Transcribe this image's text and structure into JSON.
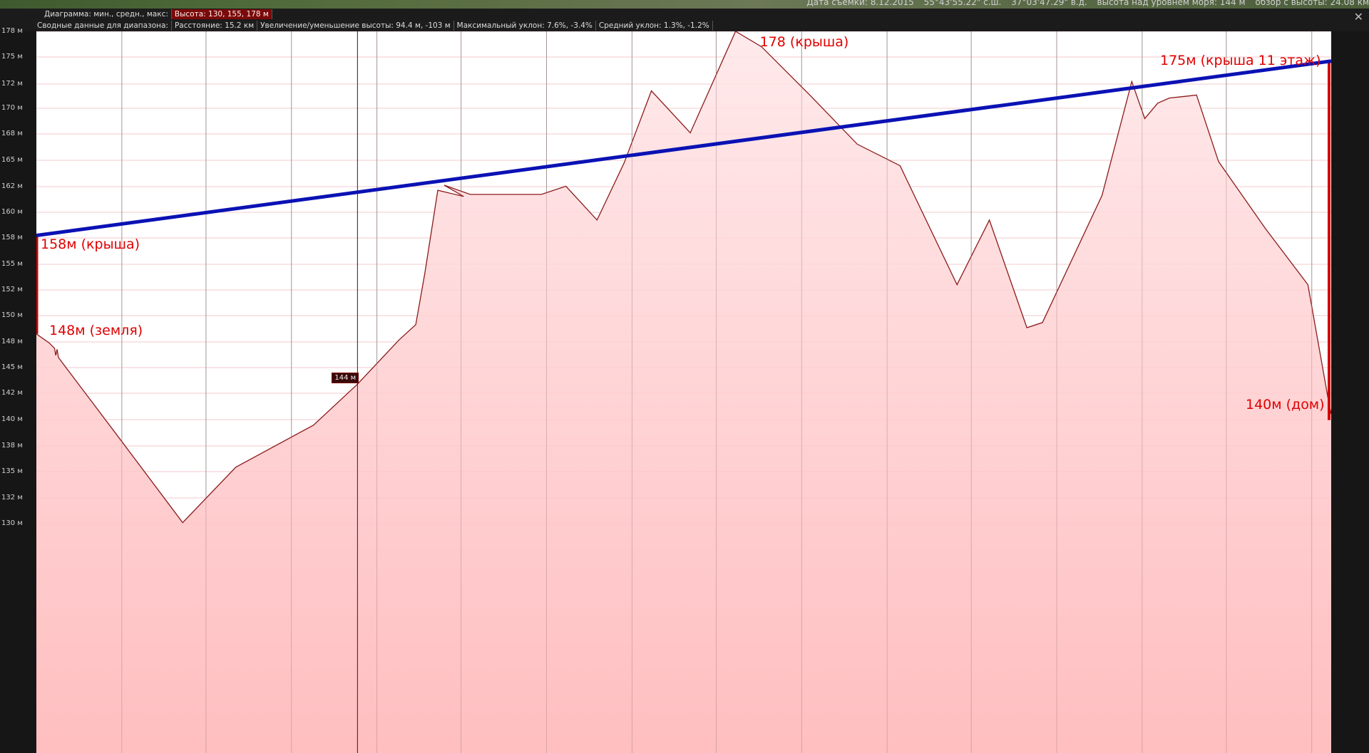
{
  "statusbar": {
    "capture_date": "Дата съемки: 8.12.2015",
    "lat": "55°43'55.22\" с.ш.",
    "lon": "37°03'47.29\" в.д.",
    "elevation": "высота над уровнем моря:   144 м",
    "eye_alt": "обзор с высоты: 24.08 км"
  },
  "header": {
    "chart_label": "Диаграмма: мин., средн., макс:",
    "height_stats": "Высота: 130, 155, 178 м",
    "summary_label": "Сводные данные для диапазона:",
    "distance": "Расстояние: 15.2 км",
    "gain_loss": "Увеличение/уменьшение высоты: 94.4 м, -103 м",
    "max_slope": "Максимальный уклон: 7.6%, -3.4%",
    "avg_slope": "Средний уклон: 1.3%, -1.2%"
  },
  "close_icon": "close-icon",
  "hover": {
    "value": "144 м"
  },
  "annotations": {
    "a158": "158м (крыша)",
    "a148": "148м (земля)",
    "a178": "178 (крыша)",
    "a175": "175м (крыша 11 этаж)",
    "a140": "140м (дом)"
  },
  "colors": {
    "profile_line": "#8b1a1a",
    "fill_top": "#ffe6e8",
    "fill_bottom": "#ffb3b5",
    "sightline": "#0a12b4",
    "annotation": "#e00000",
    "marker": "#d00000"
  },
  "chart_data": {
    "type": "area",
    "x_units": "fraction of 15.2 km path",
    "ylim": [
      126.5,
      178.8
    ],
    "yticks": [
      "178 м",
      "175 м",
      "172 м",
      "170 м",
      "168 м",
      "165 м",
      "162 м",
      "160 м",
      "158 м",
      "155 м",
      "152 м",
      "150 м",
      "148 м",
      "145 м",
      "142 м",
      "140 м",
      "138 м",
      "135 м",
      "132 м",
      "130 м"
    ],
    "profile": [
      [
        0.0,
        148.5
      ],
      [
        0.01,
        147.6
      ],
      [
        0.014,
        147.1
      ],
      [
        0.015,
        146.4
      ],
      [
        0.016,
        147.0
      ],
      [
        0.017,
        146.2
      ],
      [
        0.066,
        138.0
      ],
      [
        0.113,
        130.1
      ],
      [
        0.154,
        135.5
      ],
      [
        0.214,
        139.6
      ],
      [
        0.248,
        143.6
      ],
      [
        0.28,
        147.9
      ],
      [
        0.293,
        149.4
      ],
      [
        0.3,
        154.4
      ],
      [
        0.31,
        162.5
      ],
      [
        0.33,
        161.9
      ],
      [
        0.315,
        163.0
      ],
      [
        0.335,
        162.1
      ],
      [
        0.369,
        162.1
      ],
      [
        0.39,
        162.1
      ],
      [
        0.409,
        162.9
      ],
      [
        0.433,
        159.6
      ],
      [
        0.454,
        165.2
      ],
      [
        0.475,
        172.2
      ],
      [
        0.505,
        168.1
      ],
      [
        0.54,
        178.0
      ],
      [
        0.56,
        176.5
      ],
      [
        0.598,
        171.7
      ],
      [
        0.634,
        167.0
      ],
      [
        0.667,
        164.9
      ],
      [
        0.711,
        153.3
      ],
      [
        0.736,
        159.6
      ],
      [
        0.765,
        149.1
      ],
      [
        0.777,
        149.6
      ],
      [
        0.823,
        162.0
      ],
      [
        0.846,
        173.1
      ],
      [
        0.856,
        169.5
      ],
      [
        0.866,
        171.0
      ],
      [
        0.875,
        171.5
      ],
      [
        0.89,
        171.7
      ],
      [
        0.896,
        171.8
      ],
      [
        0.913,
        165.3
      ],
      [
        0.949,
        158.8
      ],
      [
        0.982,
        153.3
      ],
      [
        0.998,
        141.9
      ],
      [
        1.0,
        140.7
      ]
    ],
    "sightline": {
      "from": [
        0.0,
        158.1
      ],
      "to": [
        1.0,
        175.1
      ]
    },
    "start_marker": [
      148.5,
      158.1
    ],
    "end_marker": [
      140.1,
      175.1
    ],
    "cursor_x": 0.248,
    "gridline_x_fractions": [
      0.066,
      0.131,
      0.197,
      0.263,
      0.328,
      0.394,
      0.46,
      0.525,
      0.591,
      0.657,
      0.722,
      0.788,
      0.854,
      0.919,
      0.985
    ]
  }
}
